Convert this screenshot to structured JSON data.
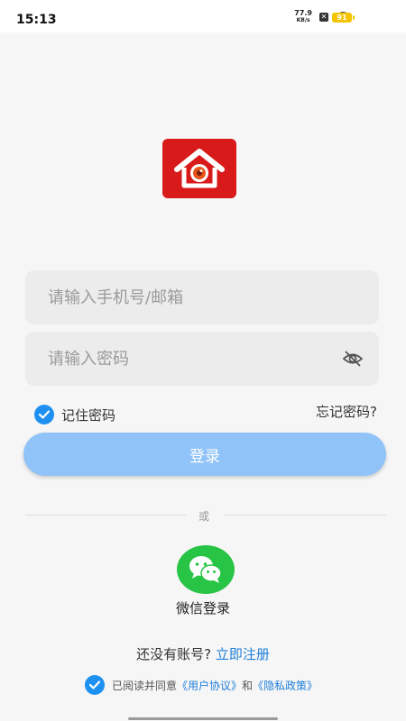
{
  "status_bar": {
    "time": "15:13",
    "net_speed_value": "77.9",
    "net_speed_unit": "KB/s",
    "battery": "91"
  },
  "login": {
    "phone_placeholder": "请输入手机号/邮箱",
    "password_placeholder": "请输入密码",
    "remember_label": "记住密码",
    "forgot_label": "忘记密码?",
    "login_button": "登录",
    "divider_text": "或",
    "wechat_label": "微信登录",
    "no_account_text": "还没有账号?",
    "register_link": "立即注册",
    "agree_prefix": "已阅读并同意",
    "user_agreement": "《用户协议》",
    "agree_and": "和",
    "privacy_policy": "《隐私政策》"
  },
  "colors": {
    "accent": "#1e90f0",
    "login_button_bg": "#90c3f7",
    "logo_bg": "#d81a1a",
    "wechat_green": "#28c445",
    "link": "#1e7fd8"
  },
  "icons": {
    "logo": "house-eye-logo",
    "password_toggle": "eye-off-icon",
    "wechat": "wechat-icon",
    "check": "check-icon"
  }
}
